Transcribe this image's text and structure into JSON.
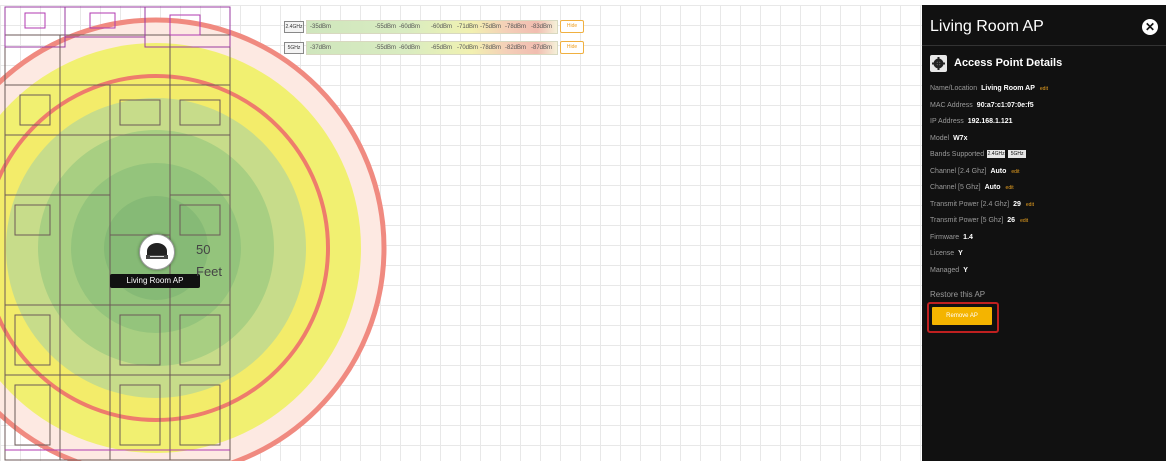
{
  "map": {
    "ap_label": "Living Room AP",
    "scale": {
      "value": "50",
      "unit": "Feet"
    },
    "legend": [
      {
        "band": "2.4GHz",
        "readings": [
          "-35dBm",
          "-55dBm",
          "-60dBm",
          "-60dBm",
          "-71dBm",
          "-75dBm",
          "-78dBm",
          "-83dBm"
        ],
        "hide_label": "Hide"
      },
      {
        "band": "5GHz",
        "readings": [
          "-37dBm",
          "-55dBm",
          "-60dBm",
          "-65dBm",
          "-70dBm",
          "-78dBm",
          "-82dBm",
          "-87dBm"
        ],
        "hide_label": "Hide"
      }
    ],
    "icons": {
      "access_point": "router-icon"
    }
  },
  "panel": {
    "title": "Living Room AP",
    "close_label": "✕",
    "section_title": "Access Point Details",
    "section_icon": "gear-icon",
    "details": {
      "name_label": "Name/Location",
      "name_value": "Living Room AP",
      "mac_label": "MAC Address",
      "mac_value": "90:a7:c1:07:0e:f5",
      "ip_label": "IP Address",
      "ip_value": "192.168.1.121",
      "model_label": "Model",
      "model_value": "W7x",
      "bands_label": "Bands Supported",
      "band_24": "2.4GHz",
      "band_5": "5GHz",
      "ch24_label": "Channel [2.4 Ghz]",
      "ch24_value": "Auto",
      "ch5_label": "Channel [5 Ghz]",
      "ch5_value": "Auto",
      "tx24_label": "Transmit Power [2.4 Ghz]",
      "tx24_value": "29",
      "tx5_label": "Transmit Power [5 Ghz]",
      "tx5_value": "26",
      "fw_label": "Firmware",
      "fw_value": "1.4",
      "license_label": "License",
      "license_value": "Y",
      "managed_label": "Managed",
      "managed_value": "Y",
      "edit_label": "edit"
    },
    "restore_title": "Restore this AP",
    "remove_button": "Remove AP"
  },
  "colors": {
    "panel_bg": "#111111",
    "accent": "#f4b400",
    "edit_link": "#e8a020",
    "highlight_frame": "#c02020",
    "coverage_outer": "#f08080",
    "coverage_yellow": "#f1f071",
    "coverage_green": "#8fc47a"
  }
}
